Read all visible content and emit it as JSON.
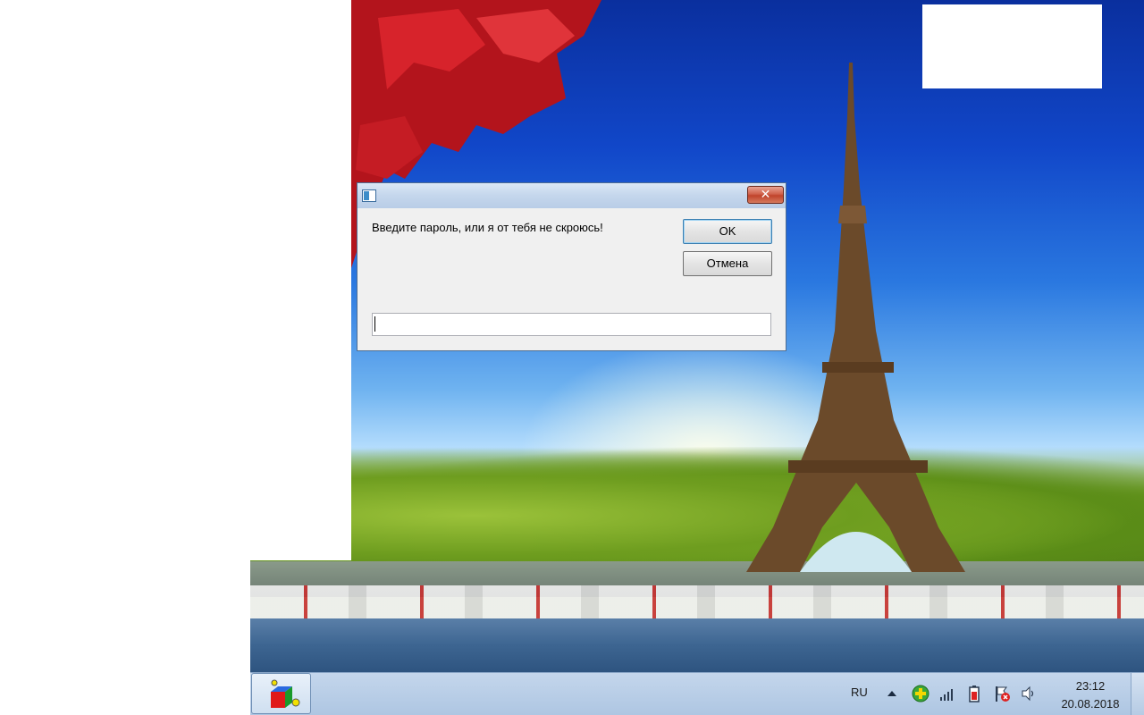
{
  "dialog": {
    "prompt": "Введите пароль, или я от тебя не скроюсь!",
    "ok_label": "OK",
    "cancel_label": "Отмена",
    "input_value": "",
    "close_icon": "close-icon"
  },
  "taskbar": {
    "language": "RU",
    "time": "23:12",
    "date": "20.08.2018",
    "tray_icons": [
      "show-hidden-icons-icon",
      "green-plus-icon",
      "network-signal-icon",
      "battery-icon",
      "action-center-flag-icon",
      "volume-icon"
    ]
  },
  "colors": {
    "close_button": "#c0432b",
    "titlebar": "#c4d6ec",
    "taskbar": "#aec6e2",
    "dialog_bg": "#f0f0f0"
  }
}
